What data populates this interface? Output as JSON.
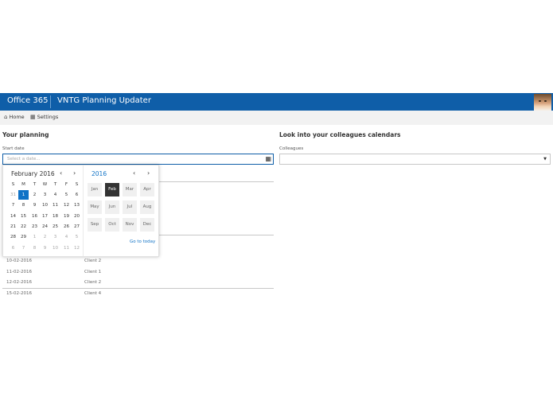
{
  "suite": {
    "brand": "Office 365",
    "app_title": "VNTG Planning Updater"
  },
  "nav": {
    "items": [
      {
        "label": "Home",
        "icon": "home-icon"
      },
      {
        "label": "Settings",
        "icon": "calendar-icon"
      }
    ]
  },
  "planning": {
    "title": "Your planning",
    "start_label": "Start date",
    "date_placeholder": "Select a date...",
    "rows": [
      {
        "date": "10-02-2016",
        "client": "Client 2"
      },
      {
        "date": "11-02-2016",
        "client": "Client 1"
      },
      {
        "date": "12-02-2016",
        "client": "Client 2"
      },
      {
        "date": "15-02-2016",
        "client": "Client 4"
      }
    ]
  },
  "colleagues": {
    "title": "Look into your colleagues calendars",
    "label": "Colleagues",
    "selected_value": ""
  },
  "datepicker": {
    "month_title": "February 2016",
    "weekdays": [
      "S",
      "M",
      "T",
      "W",
      "T",
      "F",
      "S"
    ],
    "weeks": [
      [
        "31",
        "1",
        "2",
        "3",
        "4",
        "5",
        "6"
      ],
      [
        "7",
        "8",
        "9",
        "10",
        "11",
        "12",
        "13"
      ],
      [
        "14",
        "15",
        "16",
        "17",
        "18",
        "19",
        "20"
      ],
      [
        "21",
        "22",
        "23",
        "24",
        "25",
        "26",
        "27"
      ],
      [
        "28",
        "29",
        "1",
        "2",
        "3",
        "4",
        "5"
      ],
      [
        "6",
        "7",
        "8",
        "9",
        "10",
        "11",
        "12"
      ]
    ],
    "selected_day": "1",
    "year_title": "2016",
    "months": [
      "Jan",
      "Feb",
      "Mar",
      "Apr",
      "May",
      "Jun",
      "Jul",
      "Aug",
      "Sep",
      "Oct",
      "Nov",
      "Dec"
    ],
    "selected_month": "Feb",
    "go_to_today": "Go to today"
  },
  "colors": {
    "suite_bar": "#0f5ea8",
    "accent": "#0f72c6",
    "selected_month_bg": "#333333"
  }
}
